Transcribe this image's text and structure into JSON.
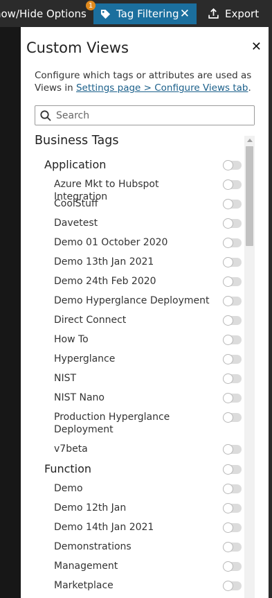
{
  "topbar": {
    "show_hide_label": "how/Hide Options",
    "badge_count": "1",
    "tag_filter_label": "Tag Filtering",
    "close_glyph": "✕",
    "export_label": "Export",
    "colors": {
      "bar": "#2b2b2b",
      "active_tab": "#1b6f9e",
      "badge": "#e08a1e"
    }
  },
  "panel": {
    "title": "Custom Views",
    "close_glyph": "✕",
    "description_prefix": "Configure which tags or attributes are used as Views in ",
    "description_link": "Settings page > Configure Views tab",
    "description_suffix": ".",
    "search_placeholder": "Search",
    "group_title": "Business Tags"
  },
  "tags": [
    {
      "type": "category",
      "label": "Application",
      "enabled": false
    },
    {
      "type": "item",
      "label": "Azure Mkt to Hubspot Integration",
      "enabled": false
    },
    {
      "type": "item",
      "label": "CoolStuff",
      "enabled": false
    },
    {
      "type": "item",
      "label": "Davetest",
      "enabled": false
    },
    {
      "type": "item",
      "label": "Demo 01 October 2020",
      "enabled": false
    },
    {
      "type": "item",
      "label": "Demo 13th Jan 2021",
      "enabled": false
    },
    {
      "type": "item",
      "label": "Demo 24th Feb 2020",
      "enabled": false
    },
    {
      "type": "item",
      "label": "Demo Hyperglance Deployment",
      "enabled": false
    },
    {
      "type": "item",
      "label": "Direct Connect",
      "enabled": false
    },
    {
      "type": "item",
      "label": "How To",
      "enabled": false
    },
    {
      "type": "item",
      "label": "Hyperglance",
      "enabled": false
    },
    {
      "type": "item",
      "label": "NIST",
      "enabled": false
    },
    {
      "type": "item",
      "label": "NIST Nano",
      "enabled": false
    },
    {
      "type": "item",
      "label": "Production Hyperglance Deployment",
      "enabled": false
    },
    {
      "type": "item",
      "label": "v7beta",
      "enabled": false
    },
    {
      "type": "category",
      "label": "Function",
      "enabled": false
    },
    {
      "type": "item",
      "label": "Demo",
      "enabled": false
    },
    {
      "type": "item",
      "label": "Demo 12th Jan",
      "enabled": false
    },
    {
      "type": "item",
      "label": "Demo 14th Jan 2021",
      "enabled": false
    },
    {
      "type": "item",
      "label": "Demonstrations",
      "enabled": false
    },
    {
      "type": "item",
      "label": "Management",
      "enabled": false
    },
    {
      "type": "item",
      "label": "Marketplace",
      "enabled": false
    }
  ]
}
